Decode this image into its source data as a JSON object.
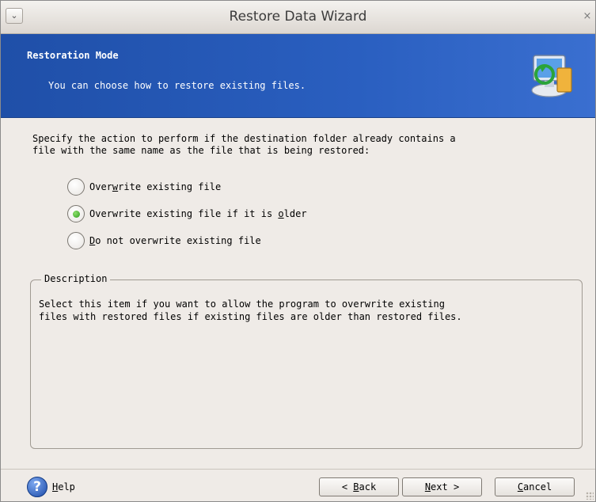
{
  "window": {
    "title": "Restore Data Wizard",
    "menu_icon": "chevron-down-icon",
    "close_icon": "close-icon",
    "close_glyph": "×"
  },
  "banner": {
    "title": "Restoration Mode",
    "subtitle": "You can choose how to restore existing files.",
    "icon": "restore-computer-icon",
    "color": "#2a5fc0"
  },
  "prompt": "Specify the action to perform if the destination folder already contains a\nfile with the same name as the file that is being restored:",
  "options": [
    {
      "pre": "Over",
      "key": "w",
      "post": "rite existing file",
      "checked": false
    },
    {
      "pre": "Overwrite existing file if it is ",
      "key": "o",
      "post": "lder",
      "checked": true
    },
    {
      "pre": "",
      "key": "D",
      "post": "o not overwrite existing file",
      "checked": false
    }
  ],
  "description": {
    "legend": "Description",
    "text": "Select this item if you want to allow the program to overwrite existing\nfiles with restored files if existing files are older than restored files."
  },
  "footer": {
    "help": {
      "pre": "",
      "key": "H",
      "post": "elp",
      "icon": "help-icon",
      "glyph": "?"
    },
    "back": {
      "pre": "< ",
      "key": "B",
      "post": "ack"
    },
    "next": {
      "pre": "",
      "key": "N",
      "post": "ext >"
    },
    "cancel": {
      "pre": "",
      "key": "C",
      "post": "ancel"
    }
  }
}
